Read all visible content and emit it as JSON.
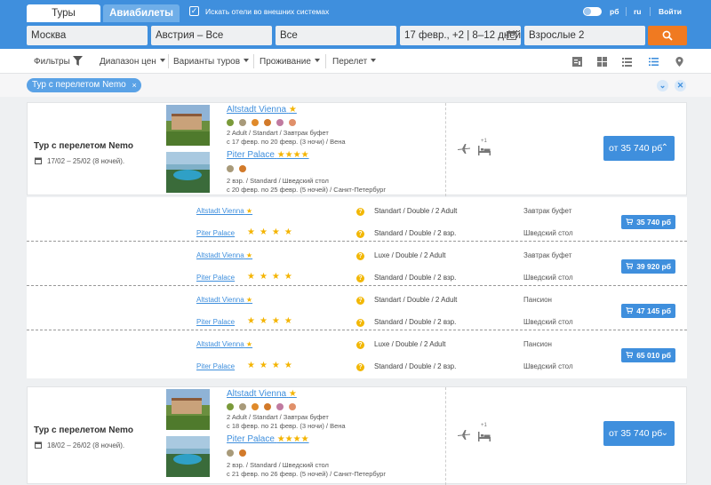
{
  "topbar": {
    "tab_tours": "Туры",
    "tab_avia": "Авиабилеты",
    "search_external": "Искать отели во внешних системах",
    "currency": "рб",
    "lang": "ru",
    "login": "Войти"
  },
  "search": {
    "from": "Москва",
    "to": "Австрия – Все",
    "resort": "Все",
    "dates": "17 февр., +2 | 8–12 дней",
    "pax": "Взрослые 2"
  },
  "filters": {
    "filters": "Фильтры",
    "price_range": "Диапазон цен",
    "tour_variants": "Варианты туров",
    "accommodation": "Проживание",
    "flight": "Перелет"
  },
  "chip": {
    "label": "Тур с перелетом Nemo",
    "close": "×"
  },
  "cards": [
    {
      "title": "Тур с перелетом Nemo",
      "dates": "17/02 – 25/02 (8 ночей).",
      "hotel1": {
        "name": "Altstadt Vienna",
        "stars": "★",
        "details": "2 Adult / Standart / Завтрак буфет",
        "dates": "с 17 февр. по 20 февр. (3 ночи) / Вена"
      },
      "hotel2": {
        "name": "Piter Palace",
        "stars": "★★★★",
        "details": "2 взр. / Standard / Шведский стол",
        "dates": "с 20 февр. по 25 февр. (5 ночей) / Санкт-Петербург"
      },
      "plus": "+1",
      "price": "от 35 740 рб"
    },
    {
      "title": "Тур с перелетом Nemo",
      "dates": "18/02 – 26/02 (8 ночей).",
      "hotel1": {
        "name": "Altstadt Vienna",
        "stars": "★",
        "details": "2 Adult / Standart / Завтрак буфет",
        "dates": "с 18 февр. по 21 февр. (3 ночи) / Вена"
      },
      "hotel2": {
        "name": "Piter Palace",
        "stars": "★★★★",
        "details": "2 взр. / Standard / Шведский стол",
        "dates": "с 21 февр. по 26 февр. (5 ночей) / Санкт-Петербург"
      },
      "plus": "+1",
      "price": "от 35 740 рб"
    }
  ],
  "variants": [
    {
      "h1": "Altstadt Vienna",
      "h1_stars": "★",
      "room1": "Standart / Double / 2 Adult",
      "meal1": "Завтрак буфет",
      "h2": "Piter Palace",
      "h2_stars": "★★★★",
      "room2": "Standard / Double / 2 взр.",
      "meal2": "Шведский стол",
      "price": "35 740 рб"
    },
    {
      "h1": "Altstadt Vienna",
      "h1_stars": "★",
      "room1": "Luxe / Double / 2 Adult",
      "meal1": "Завтрак буфет",
      "h2": "Piter Palace",
      "h2_stars": "★★★★",
      "room2": "Standard / Double / 2 взр.",
      "meal2": "Шведский стол",
      "price": "39 920 рб"
    },
    {
      "h1": "Altstadt Vienna",
      "h1_stars": "★",
      "room1": "Standart / Double / 2 Adult",
      "meal1": "Пансион",
      "h2": "Piter Palace",
      "h2_stars": "★★★★",
      "room2": "Standard / Double / 2 взр.",
      "meal2": "Шведский стол",
      "price": "47 145 рб"
    },
    {
      "h1": "Altstadt Vienna",
      "h1_stars": "★",
      "room1": "Luxe / Double / 2 Adult",
      "meal1": "Пансион",
      "h2": "Piter Palace",
      "h2_stars": "★★★★",
      "room2": "Standard / Double / 2 взр.",
      "meal2": "Шведский стол",
      "price": "65 010 рб"
    }
  ],
  "colors": {
    "brand": "#3f8fdd",
    "search_button": "#f07a21",
    "stars": "#f4b400"
  }
}
